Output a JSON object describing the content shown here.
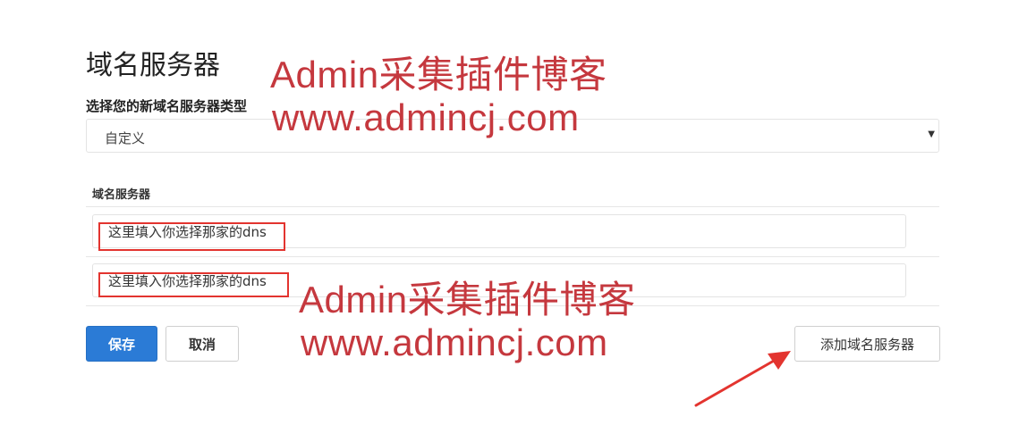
{
  "page_title": "域名服务器",
  "type_select": {
    "label": "选择您的新域名服务器类型",
    "selected": "自定义"
  },
  "nameservers": {
    "header": "域名服务器",
    "rows": [
      {
        "value": "这里填入你选择那家的dns"
      },
      {
        "value": "这里填入你选择那家的dns"
      }
    ]
  },
  "buttons": {
    "save": "保存",
    "cancel": "取消",
    "add_nameserver": "添加域名服务器"
  },
  "watermark": {
    "line1": "Admin采集插件博客",
    "line2": "www.admincj.com"
  },
  "colors": {
    "primary": "#2b7bd6",
    "highlight": "#e3342f",
    "watermark": "#c5383e"
  }
}
